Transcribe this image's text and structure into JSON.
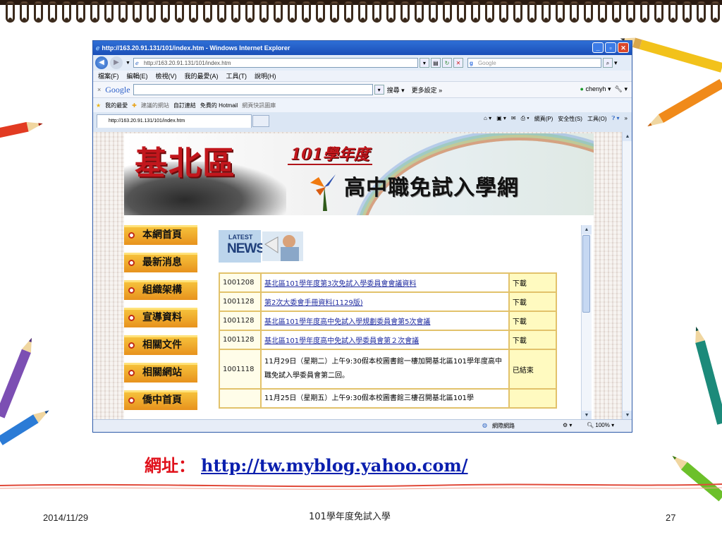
{
  "browser": {
    "window_title": "http://163.20.91.131/101/index.htm - Windows Internet Explorer",
    "address": "http://163.20.91.131/101/index.htm",
    "search_placeholder": "Google",
    "menu": [
      "檔案(F)",
      "編輯(E)",
      "檢視(V)",
      "我的最愛(A)",
      "工具(T)",
      "說明(H)"
    ],
    "google_bar": {
      "logo": "Google",
      "search_btn": "搜尋",
      "more": "更多設定 »",
      "user": "chenyh"
    },
    "favorites": [
      "我的最愛",
      "建議的網站",
      "自訂連結",
      "免費的 Hotmail",
      "網頁快訊圖庫"
    ],
    "tab_title": "http://163.20.91.131/101/index.htm",
    "commands": [
      "網頁(P)",
      "安全性(S)",
      "工具(O)"
    ],
    "status": {
      "zone": "網際網路",
      "zoom": "100%"
    }
  },
  "site": {
    "banner_main": "基北區",
    "banner_year": "101學年度",
    "banner_sub": "高中職免試入學網",
    "menu": [
      "本網首頁",
      "最新消息",
      "組織架構",
      "宣導資料",
      "相關文件",
      "相關網站",
      "僑中首頁"
    ],
    "news_latest": "LATEST",
    "news_label": "NEWS",
    "news": [
      {
        "date": "1001208",
        "title": "基北區101學年度第3次免試入學委員會會議資料",
        "status": "下載",
        "link": true
      },
      {
        "date": "1001128",
        "title": "第2次大委會手冊資料(1129版)",
        "status": "下載",
        "link": true
      },
      {
        "date": "1001128",
        "title": "基北區101學年度高中免試入學規劃委員會第5次會議",
        "status": "下載",
        "link": true
      },
      {
        "date": "1001128",
        "title": "基北區101學年度高中免試入學委員會第２次會議",
        "status": "下載",
        "link": true
      },
      {
        "date": "1001118",
        "title": "11月29日（星期二）上午9:30假本校圖書館一樓加開基北區101學年度高中職免試入學委員會第二回。",
        "status": "已結束",
        "link": false
      },
      {
        "date": "",
        "title": "11月25日（星期五）上午9:30假本校圖書館三樓召開基北區101學",
        "status": "",
        "link": false
      }
    ]
  },
  "slide": {
    "url_label": "網址：",
    "url": "http://tw.myblog.yahoo.com/",
    "date": "2014/11/29",
    "title": "101學年度免試入學",
    "page": "27"
  },
  "colors": {
    "url_red": "#e0101a",
    "url_blue": "#0b1fae",
    "banner_red": "#c2171d",
    "menu_orange": "#e7921d"
  }
}
